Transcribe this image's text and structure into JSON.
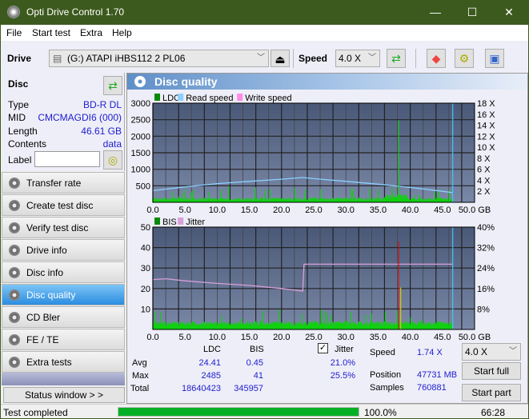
{
  "window": {
    "title": "Opti Drive Control 1.70",
    "minimize": "—",
    "maximize": "☐",
    "close": "✕"
  },
  "menu": [
    "File",
    "Start test",
    "Extra",
    "Help"
  ],
  "toolbar": {
    "drive_label": "Drive",
    "drive_value": "(G:)  ATAPI iHBS112   2 PL06",
    "speed_label": "Speed",
    "speed_value": "4.0 X"
  },
  "disc": {
    "title": "Disc",
    "type_k": "Type",
    "type_v": "BD-R DL",
    "mid_k": "MID",
    "mid_v": "CMCMAGDI6 (000)",
    "len_k": "Length",
    "len_v": "46.61 GB",
    "cont_k": "Contents",
    "cont_v": "data",
    "label_k": "Label",
    "label_v": ""
  },
  "nav": [
    "Transfer rate",
    "Create test disc",
    "Verify test disc",
    "Drive info",
    "Disc info",
    "Disc quality",
    "CD Bler",
    "FE / TE",
    "Extra tests"
  ],
  "nav_active": 5,
  "status_window": "Status window > >",
  "panel": {
    "title": "Disc quality"
  },
  "chart_data": [
    {
      "type": "bar",
      "title": "LDC / Read speed",
      "legend": [
        "LDC",
        "Read speed",
        "Write speed"
      ],
      "xlabel": "GB",
      "xlim": [
        0,
        50
      ],
      "ylim": [
        0,
        3000
      ],
      "y2lim": [
        0,
        18
      ],
      "xticks": [
        "0.0",
        "5.0",
        "10.0",
        "15.0",
        "20.0",
        "25.0",
        "30.0",
        "35.0",
        "40.0",
        "45.0",
        "50.0 GB"
      ],
      "yticks": [
        "3000",
        "2500",
        "2000",
        "1500",
        "1000",
        "500"
      ],
      "y2ticks": [
        "18 X",
        "16 X",
        "14 X",
        "12 X",
        "10 X",
        "8 X",
        "6 X",
        "4 X",
        "2 X"
      ],
      "read_speed": {
        "x": [
          0,
          2,
          5,
          10,
          15,
          20,
          23.3,
          25,
          30,
          35,
          40,
          45,
          46.6
        ],
        "y": [
          2.1,
          2.4,
          2.8,
          3.4,
          3.8,
          4.2,
          4.5,
          4.3,
          3.8,
          3.3,
          2.7,
          2.0,
          1.74
        ]
      },
      "ldc_peak": {
        "x": 38.2,
        "y": 2485
      }
    },
    {
      "type": "bar",
      "title": "BIS / Jitter",
      "legend": [
        "BIS",
        "Jitter"
      ],
      "xlabel": "GB",
      "xlim": [
        0,
        50
      ],
      "ylim": [
        0,
        50
      ],
      "y2lim": [
        0,
        40
      ],
      "xticks": [
        "0.0",
        "5.0",
        "10.0",
        "15.0",
        "20.0",
        "25.0",
        "30.0",
        "35.0",
        "40.0",
        "45.0",
        "50.0 GB"
      ],
      "yticks": [
        "50",
        "40",
        "30",
        "20",
        "10"
      ],
      "y2ticks": [
        "40%",
        "32%",
        "24%",
        "16%",
        "8%"
      ],
      "jitter": {
        "x": [
          0,
          2,
          5,
          10,
          15,
          20,
          23.3,
          23.5,
          38.2,
          46.6
        ],
        "y": [
          19.5,
          19.8,
          19,
          18,
          17.2,
          16,
          15,
          25.5,
          25.5,
          25.5
        ]
      },
      "bis_peak": {
        "x": 38.5,
        "y": 41
      }
    }
  ],
  "stats": {
    "col_ldc": "LDC",
    "col_bis": "BIS",
    "jitter_label": "Jitter",
    "jitter_checked": true,
    "avg_k": "Avg",
    "avg_ldc": "24.41",
    "avg_bis": "0.45",
    "avg_jit": "21.0%",
    "max_k": "Max",
    "max_ldc": "2485",
    "max_bis": "41",
    "max_jit": "25.5%",
    "total_k": "Total",
    "total_ldc": "18640423",
    "total_bis": "345957"
  },
  "info": {
    "speed_k": "Speed",
    "speed_v": "1.74 X",
    "pos_k": "Position",
    "pos_v": "47731 MB",
    "samp_k": "Samples",
    "samp_v": "760881",
    "speed_select": "4.0 X",
    "start_full": "Start full",
    "start_part": "Start part"
  },
  "statusbar": {
    "text": "Test completed",
    "progress_pct": 100,
    "progress_text": "100.0%",
    "time": "66:28"
  }
}
